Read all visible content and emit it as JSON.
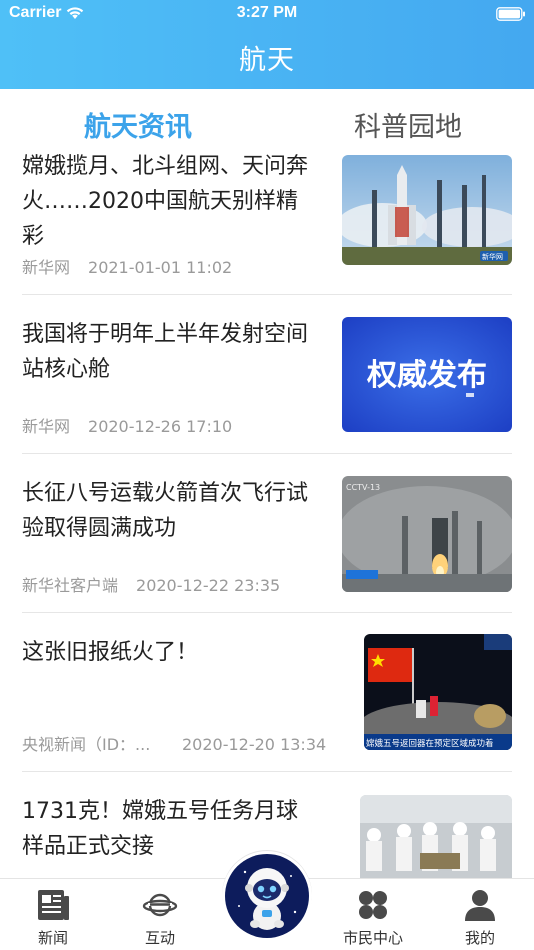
{
  "status_bar": {
    "carrier": "Carrier",
    "time": "3:27 PM"
  },
  "header": {
    "title": "航天"
  },
  "tabs": [
    {
      "label": "航天资讯",
      "active": true
    },
    {
      "label": "科普园地",
      "active": false
    }
  ],
  "news": [
    {
      "title": "嫦娥揽月、北斗组网、天问奔火……2020中国航天别样精彩",
      "source": "新华网",
      "time": "2021-01-01 11:02",
      "thumb_icon": "rocket-launch-image",
      "thumb_badge": "新华网"
    },
    {
      "title": "我国将于明年上半年发射空间站核心舱",
      "source": "新华网",
      "time": "2020-12-26 17:10",
      "thumb_icon": "announcement-banner-image",
      "thumb_text": "权威发布"
    },
    {
      "title": "长征八号运载火箭首次飞行试验取得圆满成功",
      "source": "新华社客户端",
      "time": "2020-12-22 23:35",
      "thumb_icon": "rocket-launch-smoke-image",
      "thumb_badge": "CCTV-13"
    },
    {
      "title": "这张旧报纸火了！",
      "source": "央视新闻（ID：...",
      "time": "2020-12-20 13:34",
      "thumb_icon": "lunar-flag-image",
      "thumb_caption": "嫦娥五号返回器在预定区域成功着"
    },
    {
      "title": "1731克！嫦娥五号任务月球样品正式交接",
      "source": "",
      "time": "",
      "thumb_icon": "sample-handover-image"
    }
  ],
  "tabbar": [
    {
      "label": "新闻",
      "icon": "news-icon"
    },
    {
      "label": "互动",
      "icon": "planet-icon"
    },
    {
      "label": "",
      "icon": "astronaut-mascot-icon"
    },
    {
      "label": "市民中心",
      "icon": "grid-clover-icon"
    },
    {
      "label": "我的",
      "icon": "person-icon"
    }
  ],
  "colors": {
    "accent": "#3ca3ea",
    "header_start": "#4fc0f7",
    "header_end": "#44a8f0"
  }
}
